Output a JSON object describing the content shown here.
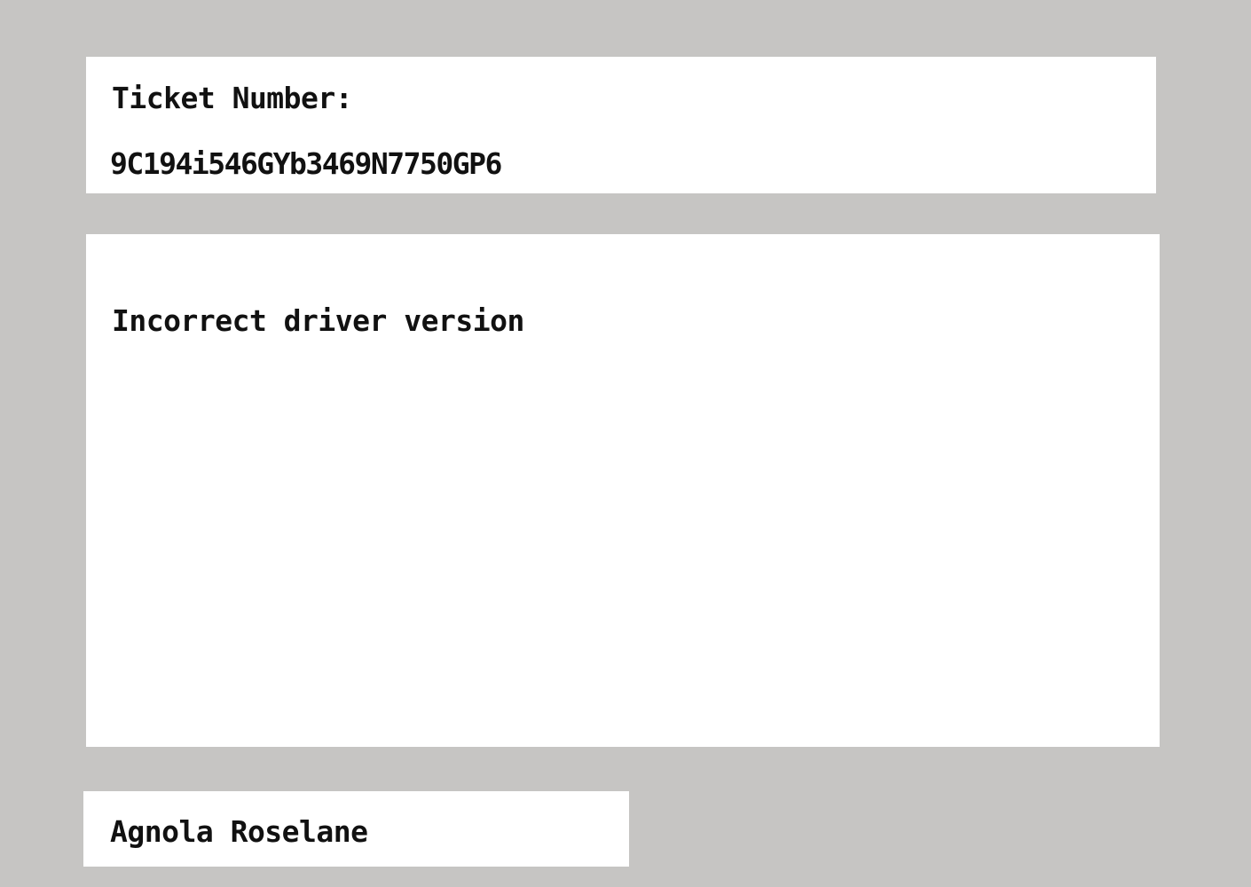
{
  "ticket": {
    "label": "Ticket Number:",
    "number": "9C194i546GYb3469N7750GP6"
  },
  "description": {
    "text": "Incorrect driver version"
  },
  "requester": {
    "name": "Agnola Roselane"
  },
  "colors": {
    "background": "#c6c5c3",
    "panel": "#ffffff",
    "text": "#111111"
  }
}
